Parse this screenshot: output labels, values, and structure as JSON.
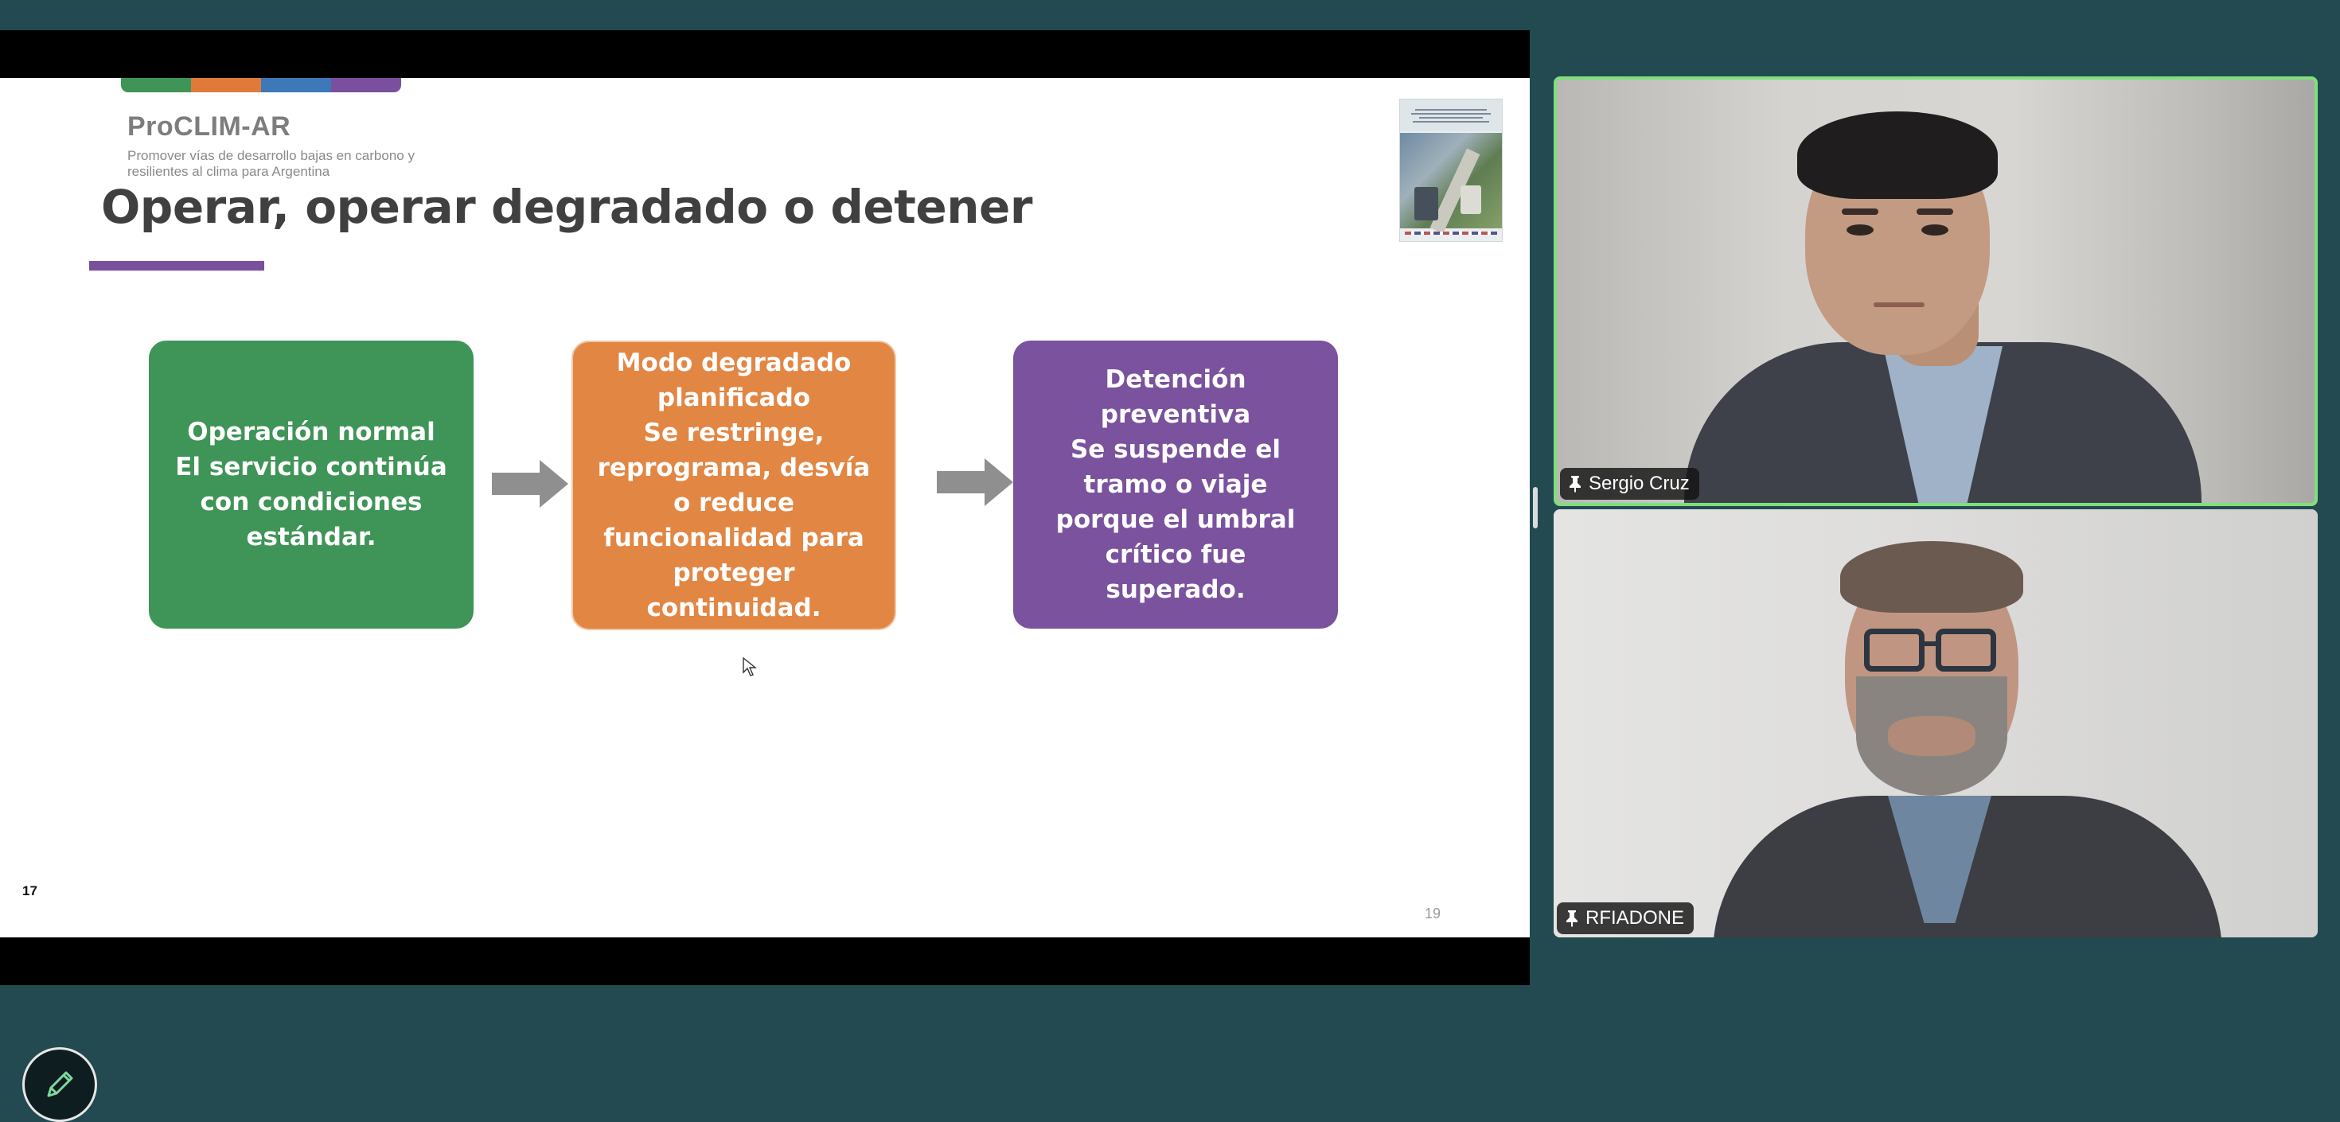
{
  "slide": {
    "brand_name": "ProCLIM-AR",
    "brand_subtitle": "Promover vías de desarrollo bajas en carbono y resilientes al clima para Argentina",
    "brand_colors": [
      "#3f9457",
      "#e07a3a",
      "#3d78b8",
      "#7a4f9e"
    ],
    "title": "Operar, operar degradado o detener",
    "accent_color": "#7a4f9e",
    "boxes": [
      {
        "text": "Operación normal\nEl servicio continúa con condiciones estándar.",
        "color": "#3f9457"
      },
      {
        "text": "Modo degradado planificado\nSe restringe, reprograma, desvía o reduce funcionalidad para proteger continuidad.",
        "color": "#e28643"
      },
      {
        "text": "Detención preventiva\nSe suspende el tramo o viaje porque el umbral crítico fue superado.",
        "color": "#7a529d"
      }
    ],
    "page_left": "17",
    "page_right": "19"
  },
  "participants": [
    {
      "name": "Sergio Cruz",
      "pinned": true,
      "speaking": true
    },
    {
      "name": "RFIADONE",
      "pinned": true,
      "speaking": false
    }
  ],
  "icons": {
    "pin": "pin-icon",
    "annotate": "pencil-icon",
    "arrow": "right-arrow-icon",
    "cursor": "mouse-cursor-icon"
  }
}
